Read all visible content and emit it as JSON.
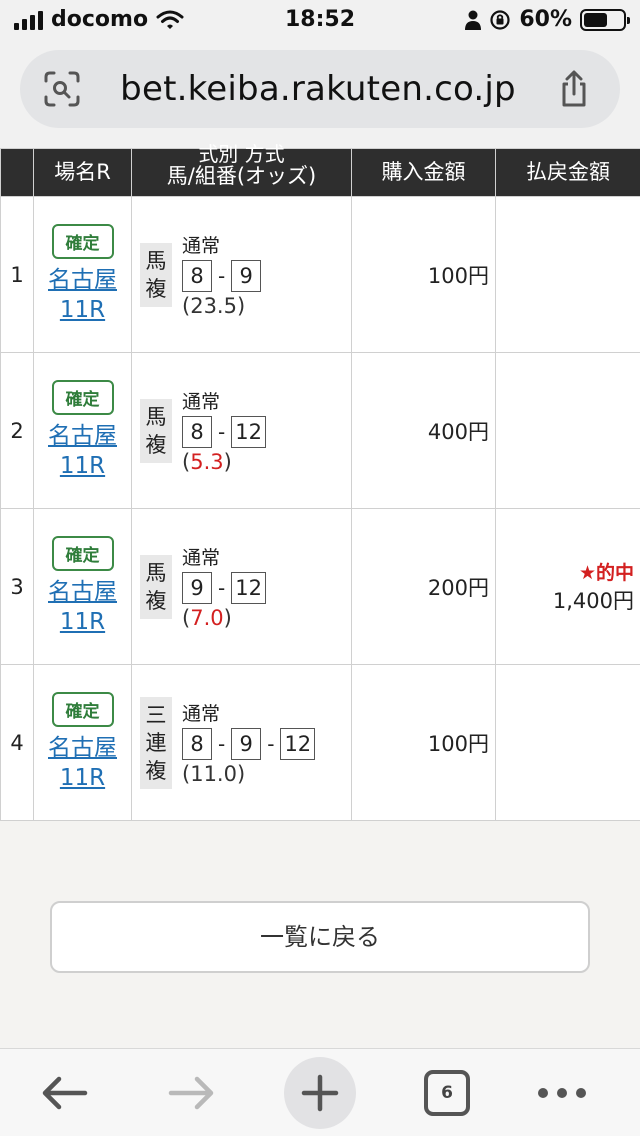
{
  "status_bar": {
    "carrier": "docomo",
    "time": "18:52",
    "battery": "60%",
    "battery_level": 0.6
  },
  "browser": {
    "url": "bet.keiba.rakuten.co.jp"
  },
  "table": {
    "headers": {
      "race": "場名R",
      "method_line1": "式別 方式",
      "method_line2": "馬/組番(オッズ)",
      "purchase": "購入金額",
      "payout": "払戻金額"
    },
    "rows": [
      {
        "num": "1",
        "status": "確定",
        "venue": "名古屋",
        "race": "11R",
        "type_chars": [
          "馬",
          "複"
        ],
        "mode": "通常",
        "horses": [
          "8",
          "9"
        ],
        "odds_open": "(",
        "odds_value": "23.5",
        "odds_close": ")",
        "amount": "100円",
        "hit_label": "",
        "payout": ""
      },
      {
        "num": "2",
        "status": "確定",
        "venue": "名古屋",
        "race": "11R",
        "type_chars": [
          "馬",
          "複"
        ],
        "mode": "通常",
        "horses": [
          "8",
          "12"
        ],
        "odds_open": "(",
        "odds_value": "5.3",
        "odds_close": ")",
        "amount": "400円",
        "hit_label": "",
        "payout": ""
      },
      {
        "num": "3",
        "status": "確定",
        "venue": "名古屋",
        "race": "11R",
        "type_chars": [
          "馬",
          "複"
        ],
        "mode": "通常",
        "horses": [
          "9",
          "12"
        ],
        "odds_open": "(",
        "odds_value": "7.0",
        "odds_close": ")",
        "amount": "200円",
        "hit_label": "★的中",
        "payout": "1,400円"
      },
      {
        "num": "4",
        "status": "確定",
        "venue": "名古屋",
        "race": "11R",
        "type_chars": [
          "三",
          "連",
          "複"
        ],
        "mode": "通常",
        "horses": [
          "8",
          "9",
          "12"
        ],
        "odds_open": "(",
        "odds_value": "11.0",
        "odds_close": ")",
        "amount": "100円",
        "hit_label": "",
        "payout": ""
      }
    ]
  },
  "back_button": {
    "label": "一覧に戻る"
  },
  "toolbar": {
    "tab_count": "6"
  },
  "colors": {
    "header_bg": "#2e2e2e",
    "link": "#1f6fb4",
    "badge_green": "#2f7d3a",
    "hot_red": "#d32020"
  },
  "icons": {
    "status": [
      "signal-icon",
      "wifi-icon",
      "person-icon",
      "orientation-lock-icon",
      "battery-icon"
    ],
    "url_bar": [
      "lens-icon",
      "share-icon"
    ],
    "toolbar": [
      "back-arrow-icon",
      "forward-arrow-icon",
      "plus-icon",
      "tabs-icon",
      "more-icon"
    ]
  }
}
